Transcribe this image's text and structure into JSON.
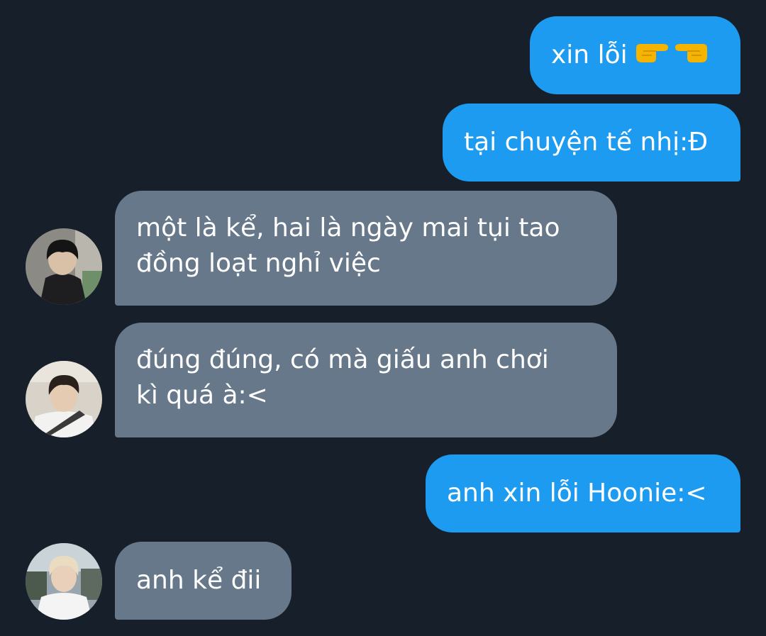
{
  "colors": {
    "background": "#17202a",
    "sent_bubble": "#1d9bf0",
    "received_bubble": "#66788a",
    "text": "#ffffff"
  },
  "messages": [
    {
      "direction": "sent",
      "text": "xin lỗi",
      "emoji": [
        "backhand-index-pointing-right",
        "backhand-index-pointing-left"
      ]
    },
    {
      "direction": "sent",
      "text": "tại chuyện tế nhị:Đ"
    },
    {
      "direction": "received",
      "lines": [
        "một là kể, hai là ngày mai tụi tao",
        "đồng loạt nghỉ việc"
      ],
      "avatar": "avatar-dark-hair-jacket"
    },
    {
      "direction": "received",
      "lines": [
        "đúng đúng, có mà giấu anh chơi",
        "kì quá à:<"
      ],
      "avatar": "avatar-seatbelt-selfie"
    },
    {
      "direction": "sent",
      "text": "anh xin lỗi Hoonie:<"
    },
    {
      "direction": "received",
      "text": "anh kể đii",
      "avatar": "avatar-blonde-hair"
    }
  ]
}
